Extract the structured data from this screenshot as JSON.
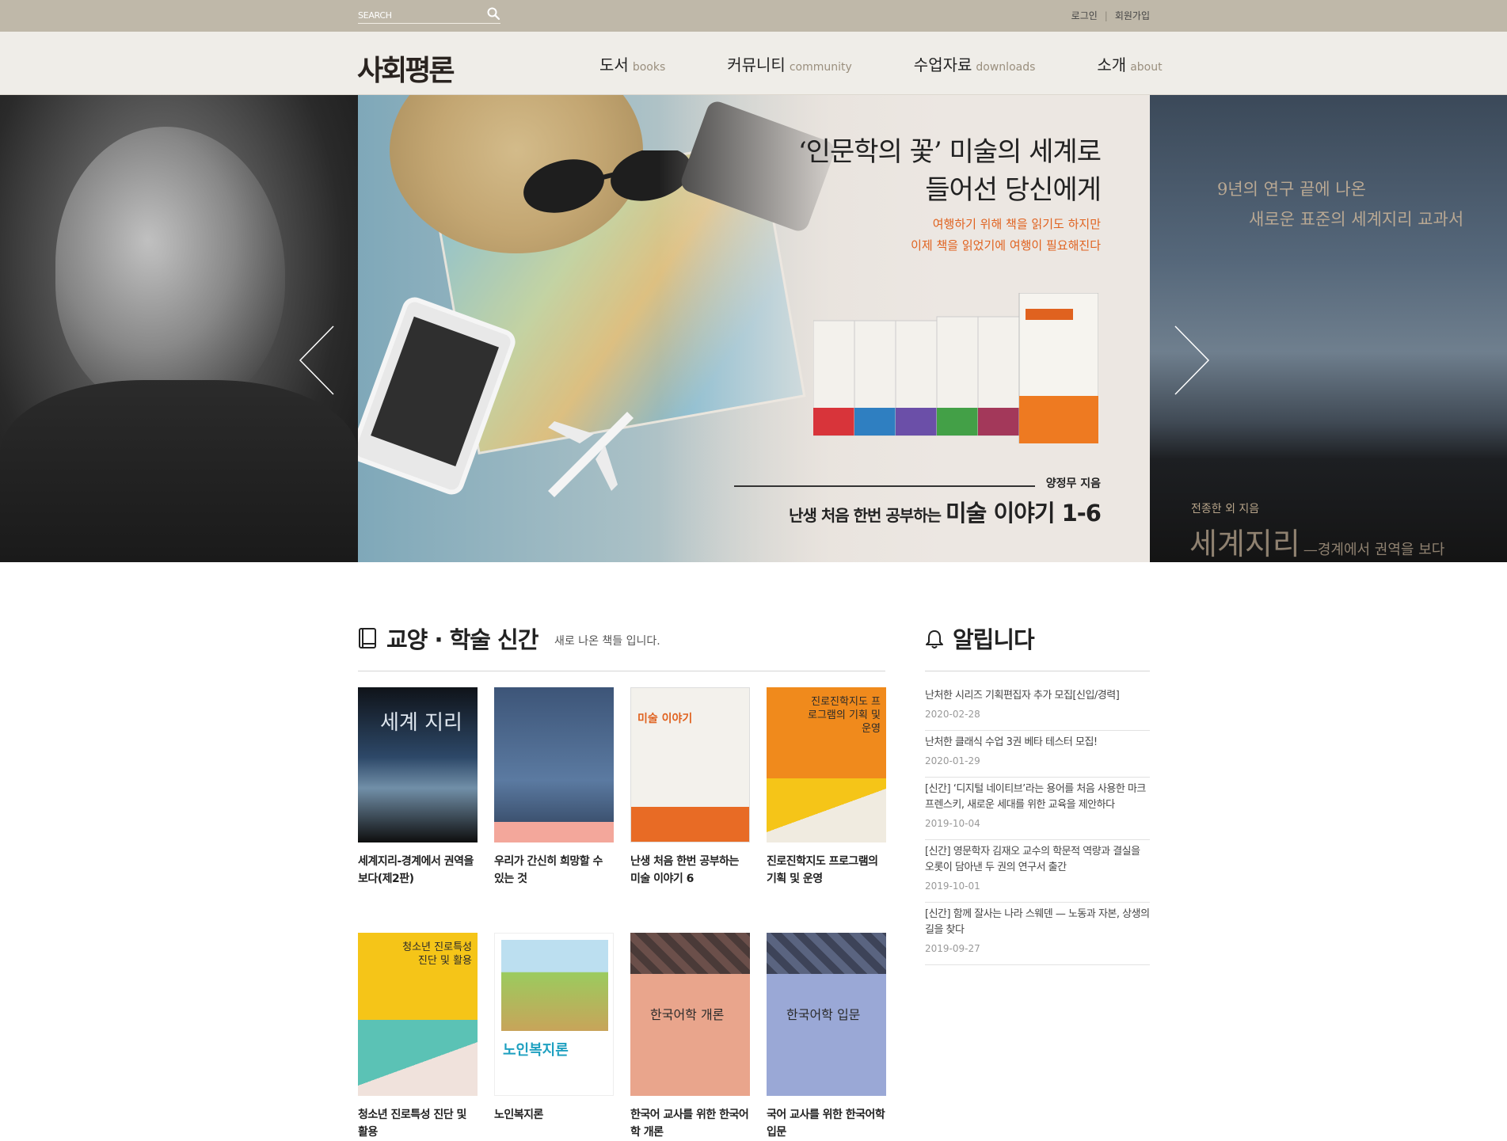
{
  "search": {
    "placeholder": "SEARCH"
  },
  "util": {
    "login": "로그인",
    "join": "회원가입"
  },
  "logo": "사회평론",
  "nav": [
    {
      "ko": "도서",
      "en": "books"
    },
    {
      "ko": "커뮤니티",
      "en": "community"
    },
    {
      "ko": "수업자료",
      "en": "downloads"
    },
    {
      "ko": "소개",
      "en": "about"
    }
  ],
  "hero": {
    "headline_line1": "‘인문학의 꽃’ 미술의 세계로",
    "headline_line2": "들어선 당신에게",
    "sub_line1": "여행하기 위해 책을 읽기도 하지만",
    "sub_line2": "이제 책을 읽었기에 여행이 필요해진다",
    "book_author": "양정무 지음",
    "book_title_small": "난생 처음 한번 공부하는",
    "book_title_big": "미술 이야기 1-6",
    "right_text_line1": "9년의 연구 끝에 나온",
    "right_text_line2": "새로운 표준의 세계지리 교과서",
    "right_author": "전종한 외 지음",
    "right_title_big": "세계지리",
    "right_title_sub": "—경계에서 권역을 보다"
  },
  "new_books": {
    "title": "교양 · 학술 신간",
    "subtitle": "새로 나온 책들 입니다.",
    "items": [
      {
        "name": "세계지리-경계에서 권역을 보다(제2판)",
        "cover_text": "세계 지리",
        "cover_color": "#1b2430"
      },
      {
        "name": "우리가 간신히 희망할 수 있는 것",
        "cover_text": "",
        "cover_color": "#4c6a8f"
      },
      {
        "name": "난생 처음 한번 공부하는 미술 이야기 6",
        "cover_text": "미술 이야기",
        "cover_color": "#f3f1ec"
      },
      {
        "name": "진로진학지도 프로그램의 기획 및 운영",
        "cover_text": "진로진학지도 프로그램의 기획 및 운영",
        "cover_color": "#f08a1c"
      },
      {
        "name": "청소년 진로특성 진단 및 활용",
        "cover_text": "청소년 진로특성 진단 및 활용",
        "cover_color": "#f5c518"
      },
      {
        "name": "노인복지론",
        "cover_text": "노인복지론",
        "cover_color": "#ffffff"
      },
      {
        "name": "한국어 교사를 위한 한국어학 개론",
        "cover_text": "한국어학 개론",
        "cover_color": "#e9a58c"
      },
      {
        "name": "국어 교사를 위한 한국어학 입문",
        "cover_text": "한국어학 입문",
        "cover_color": "#9aa8d6"
      }
    ]
  },
  "notices": {
    "title": "알립니다",
    "items": [
      {
        "text": "난처한 시리즈 기획편집자 추가 모집[신입/경력]",
        "date": "2020-02-28"
      },
      {
        "text": "난처한 클래식 수업 3권 베타 테스터 모집!",
        "date": "2020-01-29"
      },
      {
        "text": "[신간] ‘디지털 네이티브’라는 용어를 처음 사용한 마크 프렌스키, 새로운 세대를 위한 교육을 제안하다",
        "date": "2019-10-04"
      },
      {
        "text": "[신간] 영문학자 김재오 교수의 학문적 역량과 결실을 오롯이 담아낸 두 권의 연구서 출간",
        "date": "2019-10-01"
      },
      {
        "text": "[신간] 함께 잘사는 나라 스웨덴 — 노동과 자본, 상생의 길을 찾다",
        "date": "2019-09-27"
      }
    ]
  },
  "colors": {
    "topbar": "#bfb8a9",
    "header": "#efede8",
    "accent_orange": "#e0621f"
  }
}
